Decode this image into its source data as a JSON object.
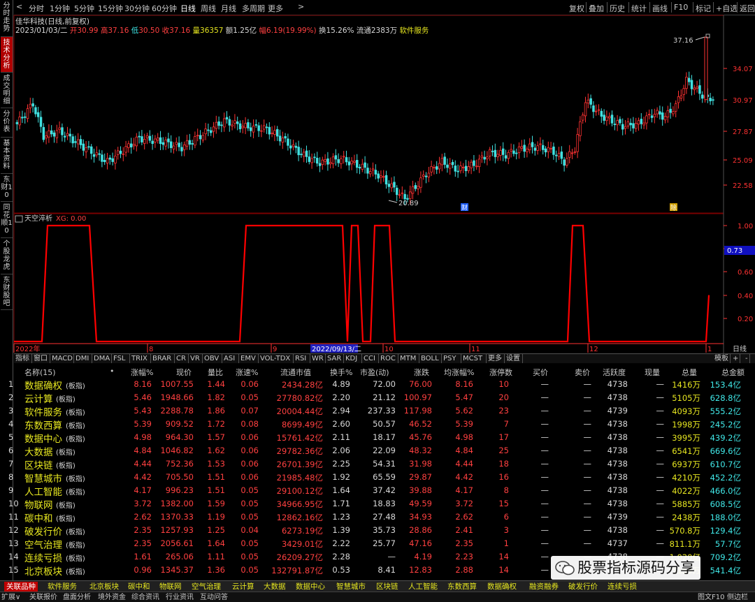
{
  "side_tabs": [
    {
      "label": "分时走势",
      "active": false
    },
    {
      "label": "技术分析",
      "active": true
    },
    {
      "label": "成交明细",
      "active": false
    },
    {
      "label": "分价表",
      "active": false
    },
    {
      "label": "基本资料",
      "active": false
    },
    {
      "label": "东财10",
      "active": false
    },
    {
      "label": "同花顺10",
      "active": false
    },
    {
      "label": "个股龙虎",
      "active": false
    },
    {
      "label": "东财股吧",
      "active": false
    }
  ],
  "period_bar": {
    "back_arrow": "<",
    "forward_arrow": ">",
    "items": [
      {
        "label": "分时",
        "active": false
      },
      {
        "label": "1分钟",
        "active": false
      },
      {
        "label": "5分钟",
        "active": false
      },
      {
        "label": "15分钟",
        "active": false
      },
      {
        "label": "30分钟",
        "active": false
      },
      {
        "label": "60分钟",
        "active": false
      },
      {
        "label": "日线",
        "active": true
      },
      {
        "label": "周线",
        "active": false
      },
      {
        "label": "月线",
        "active": false
      },
      {
        "label": "多周期",
        "active": false
      },
      {
        "label": "更多",
        "active": false
      }
    ],
    "right_items": [
      "复权",
      "叠加",
      "历史",
      "统计",
      "画线",
      "F10",
      "标记",
      "+自选",
      "返回"
    ]
  },
  "stock": {
    "name": "佳华科技",
    "mode": "(日线,前复权)",
    "date": "2023/01/03/二",
    "open_label": "开",
    "open": "30.99",
    "high_label": "高",
    "high": "37.16",
    "low_label": "低",
    "low": "30.50",
    "close_label": "收",
    "close": "37.16",
    "vol_label": "量",
    "volume": "36357",
    "amount_label": "额",
    "amount": "1.25亿",
    "change_label": "幅",
    "change": "6.19(19.99%)",
    "turnover": "换15.26%",
    "float": "流通2383万",
    "industry": "软件服务"
  },
  "kline": {
    "y_ticks": [
      "34.07",
      "30.97",
      "27.87",
      "25.09",
      "22.58"
    ],
    "high_marker": "37.16",
    "low_marker": "20.89",
    "markers": [
      "财",
      "除"
    ]
  },
  "indicator": {
    "name": "天空淬析",
    "xg": "XG: 0.00",
    "y_ticks": [
      "1.00",
      "0.80",
      "0.60",
      "0.40",
      "0.20"
    ],
    "current_value": "0.73",
    "date_axis": [
      "2022年",
      "8",
      "9",
      "10",
      "11",
      "12",
      "1"
    ],
    "cursor_date": "2022/09/13/二",
    "period_label": "日线"
  },
  "indicator_tabs": [
    "指标",
    "窗口",
    "MACD",
    "DMI",
    "DMA",
    "FSL",
    "TRIX",
    "BRAR",
    "CR",
    "VR",
    "OBV",
    "ASI",
    "EMV",
    "VOL-TDX",
    "RSI",
    "WR",
    "SAR",
    "KDJ",
    "CCI",
    "ROC",
    "MTM",
    "BOLL",
    "PSY",
    "MCST",
    "更多",
    "设置"
  ],
  "indicator_tabs_right": [
    "模板",
    "+",
    "-"
  ],
  "table": {
    "headers": [
      "名称(15)",
      "•",
      "涨幅%",
      "现价",
      "量比",
      "涨速%",
      "流通市值",
      "换手%",
      "市盈(动)",
      "涨跌",
      "均涨幅%",
      "涨停数",
      "买价",
      "卖价",
      "活跃度",
      "现量",
      "总量",
      "总金额"
    ],
    "tag": "(板指)",
    "rows": [
      [
        "1",
        "数据确权",
        "8.16",
        "1007.55",
        "1.44",
        "0.06",
        "2434.28亿",
        "4.89",
        "72.00",
        "76.00",
        "8.16",
        "10",
        "—",
        "—",
        "4738",
        "—",
        "1416万",
        "153.4亿"
      ],
      [
        "2",
        "云计算",
        "5.46",
        "1948.66",
        "1.82",
        "0.05",
        "27780.82亿",
        "2.20",
        "21.12",
        "100.97",
        "5.47",
        "20",
        "—",
        "—",
        "4738",
        "—",
        "5105万",
        "628.8亿"
      ],
      [
        "3",
        "软件服务",
        "5.43",
        "2288.78",
        "1.86",
        "0.07",
        "20004.44亿",
        "2.94",
        "237.33",
        "117.98",
        "5.62",
        "23",
        "—",
        "—",
        "4739",
        "—",
        "4093万",
        "555.2亿"
      ],
      [
        "4",
        "东数西算",
        "5.39",
        "909.52",
        "1.72",
        "0.08",
        "8699.49亿",
        "2.60",
        "50.57",
        "46.52",
        "5.39",
        "7",
        "—",
        "—",
        "4738",
        "—",
        "1998万",
        "245.2亿"
      ],
      [
        "5",
        "数据中心",
        "4.98",
        "964.30",
        "1.57",
        "0.06",
        "15761.42亿",
        "2.11",
        "18.17",
        "45.76",
        "4.98",
        "17",
        "—",
        "—",
        "4738",
        "—",
        "3995万",
        "439.2亿"
      ],
      [
        "6",
        "大数据",
        "4.84",
        "1046.82",
        "1.62",
        "0.06",
        "29782.36亿",
        "2.06",
        "22.09",
        "48.32",
        "4.84",
        "25",
        "—",
        "—",
        "4738",
        "—",
        "6541万",
        "669.6亿"
      ],
      [
        "7",
        "区块链",
        "4.44",
        "752.36",
        "1.53",
        "0.06",
        "26701.39亿",
        "2.25",
        "54.31",
        "31.98",
        "4.44",
        "18",
        "—",
        "—",
        "4738",
        "—",
        "6937万",
        "610.7亿"
      ],
      [
        "8",
        "智慧城市",
        "4.42",
        "705.50",
        "1.51",
        "0.06",
        "21985.48亿",
        "1.92",
        "65.59",
        "29.87",
        "4.42",
        "16",
        "—",
        "—",
        "4738",
        "—",
        "4210万",
        "452.2亿"
      ],
      [
        "9",
        "人工智能",
        "4.17",
        "996.23",
        "1.51",
        "0.05",
        "29100.12亿",
        "1.64",
        "37.42",
        "39.88",
        "4.17",
        "8",
        "—",
        "—",
        "4738",
        "—",
        "4022万",
        "466.0亿"
      ],
      [
        "10",
        "物联网",
        "3.72",
        "1382.00",
        "1.59",
        "0.05",
        "34966.95亿",
        "1.71",
        "18.83",
        "49.59",
        "3.72",
        "15",
        "—",
        "—",
        "4738",
        "—",
        "5885万",
        "608.5亿"
      ],
      [
        "11",
        "碳中和",
        "2.62",
        "1370.33",
        "1.19",
        "0.05",
        "12862.16亿",
        "1.23",
        "27.48",
        "34.93",
        "2.62",
        "6",
        "—",
        "—",
        "4739",
        "—",
        "2438万",
        "188.0亿"
      ],
      [
        "12",
        "破发行价",
        "2.35",
        "1257.93",
        "1.25",
        "0.04",
        "6273.19亿",
        "1.39",
        "35.73",
        "28.86",
        "2.41",
        "3",
        "—",
        "—",
        "4738",
        "—",
        "570.8万",
        "129.4亿"
      ],
      [
        "13",
        "空气治理",
        "2.35",
        "2056.61",
        "1.64",
        "0.05",
        "3429.01亿",
        "2.22",
        "25.77",
        "47.16",
        "2.35",
        "1",
        "—",
        "—",
        "4737",
        "—",
        "811.1万",
        "57.7亿"
      ],
      [
        "14",
        "连续亏损",
        "1.61",
        "265.06",
        "1.11",
        "0.05",
        "26209.27亿",
        "2.28",
        "—",
        "4.19",
        "2.23",
        "14",
        "—",
        "—",
        "4738",
        "—",
        "1.020亿",
        "709.2亿"
      ],
      [
        "15",
        "北京板块",
        "0.96",
        "1345.37",
        "1.36",
        "0.05",
        "132791.87亿",
        "0.53",
        "8.41",
        "12.83",
        "2.88",
        "14",
        "—",
        "—",
        "4738",
        "—",
        "5155万",
        "541.4亿"
      ]
    ]
  },
  "bottom_tabs": [
    "关联品种",
    "软件服务",
    "北京板块",
    "碳中和",
    "物联网",
    "空气治理",
    "云计算",
    "大数据",
    "数据中心",
    "智慧城市",
    "区块链",
    "人工智能",
    "东数西算",
    "数据确权",
    "融资融券",
    "破发行价",
    "连续亏损"
  ],
  "status_bar": {
    "left": [
      "扩展∨",
      "关联报价",
      "盘面分析",
      "境外资金",
      "综合资讯",
      "行业资讯",
      "互动问答"
    ],
    "right": [
      "图文F10",
      "侧边栏"
    ]
  },
  "watermark": "股票指标源码分享",
  "colors": {
    "up": "#ff3232",
    "down": "#40e0e0",
    "grid": "#7a0000",
    "indicator_line": "#ff0000"
  }
}
